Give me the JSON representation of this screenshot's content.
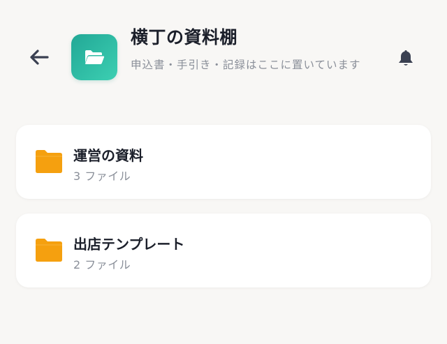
{
  "header": {
    "back_icon": "arrow-left-icon",
    "app_icon": "folder-open-icon",
    "title": "横丁の資料棚",
    "subtitle": "申込書・手引き・記録はここに置いています",
    "notification_icon": "bell-icon"
  },
  "folders": [
    {
      "name": "運営の資料",
      "count": "3 ファイル",
      "icon": "folder-icon"
    },
    {
      "name": "出店テンプレート",
      "count": "2 ファイル",
      "icon": "folder-icon"
    }
  ],
  "colors": {
    "accent": "#2bb9a2",
    "folder": "#f5a00f",
    "background": "#f8f7f5"
  }
}
